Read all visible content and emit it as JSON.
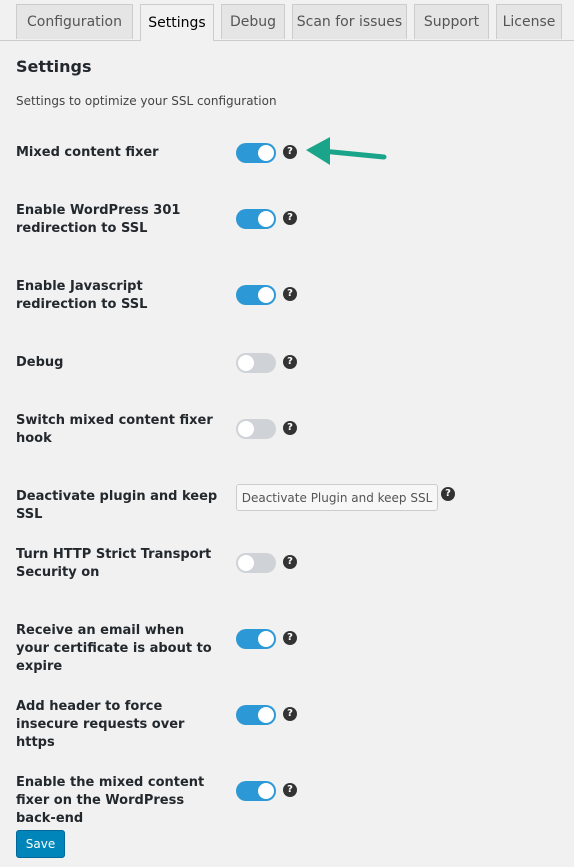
{
  "tabs": [
    "Configuration",
    "Settings",
    "Debug",
    "Scan for issues",
    "Support",
    "License"
  ],
  "active_tab": "Settings",
  "heading": "Settings",
  "subheading": "Settings to optimize your SSL configuration",
  "settings": [
    {
      "label": "Mixed content fixer",
      "state": "on"
    },
    {
      "label": "Enable WordPress 301 redirection to SSL",
      "state": "on"
    },
    {
      "label": "Enable Javascript redirection to SSL",
      "state": "on"
    },
    {
      "label": "Debug",
      "state": "off"
    },
    {
      "label": "Switch mixed content fixer hook",
      "state": "off"
    },
    {
      "label": "Deactivate plugin and keep SSL",
      "button": "Deactivate Plugin and keep SSL"
    },
    {
      "label": "Turn HTTP Strict Transport Security on",
      "state": "off"
    },
    {
      "label": "Receive an email when your certificate is about to expire",
      "state": "on"
    },
    {
      "label": "Add header to force insecure requests over https",
      "state": "on"
    },
    {
      "label": "Enable the mixed content fixer on the WordPress back-end",
      "state": "on"
    }
  ],
  "help_icon": "?",
  "save_label": "Save",
  "colors": {
    "toggle_on": "#2c98d6",
    "toggle_off": "#cfd2d6",
    "primary": "#0085ba",
    "arrow": "#1aa58a"
  },
  "icons": {
    "help": "question-circle-icon",
    "annotation": "green-arrow-icon"
  }
}
